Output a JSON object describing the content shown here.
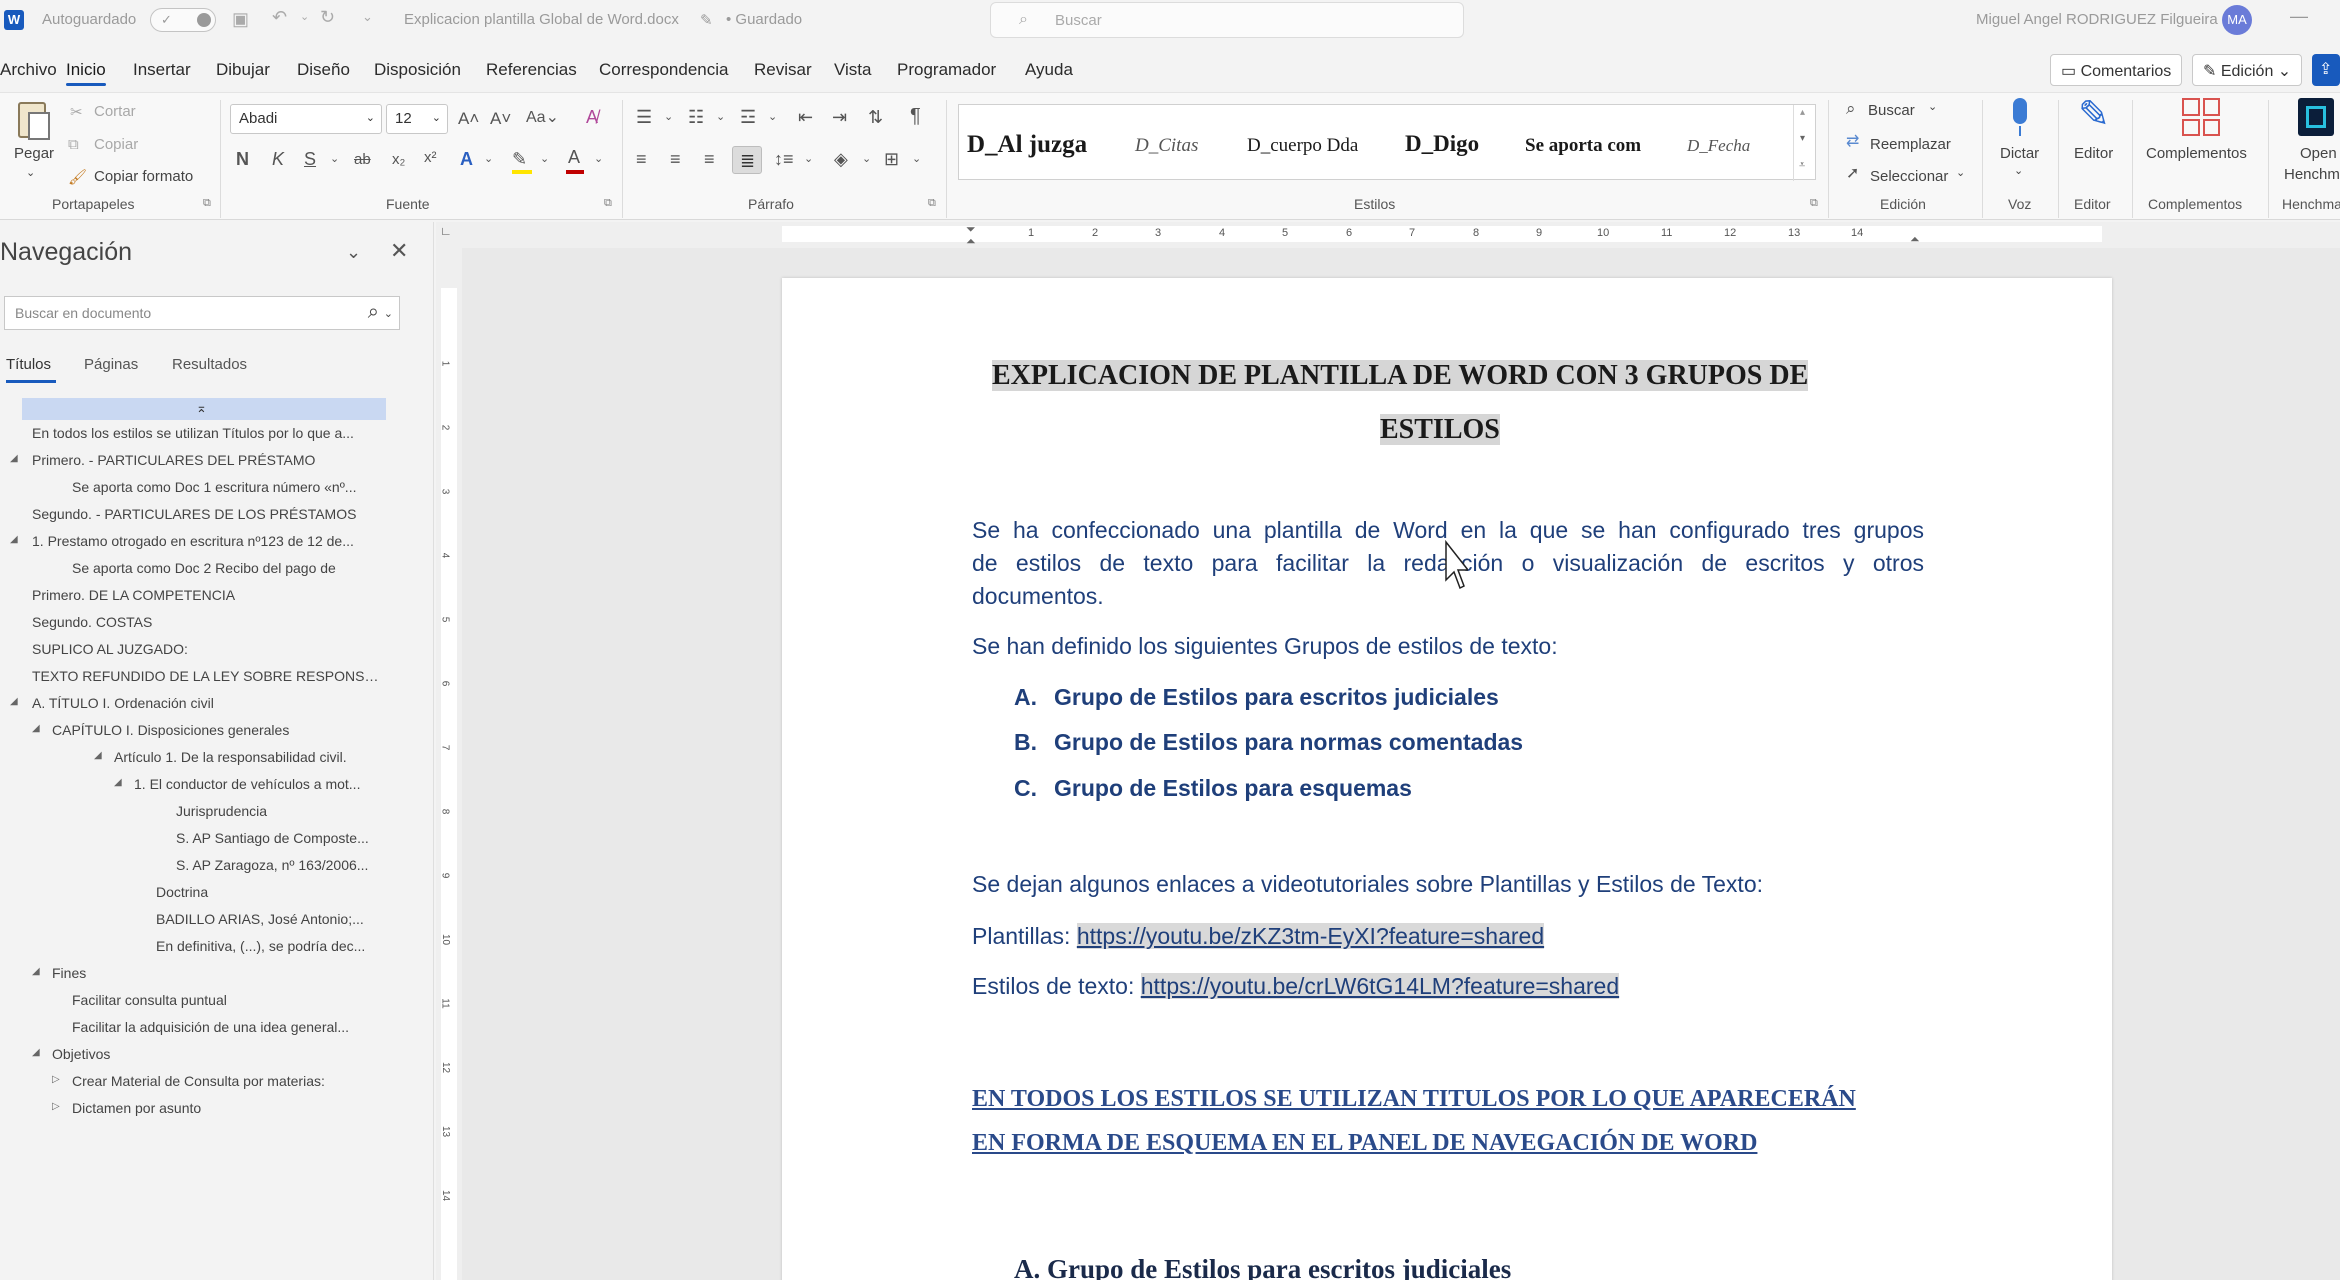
{
  "titlebar": {
    "autosave": "Autoguardado",
    "filename": "Explicacion plantilla Global de Word.docx",
    "save_status": "• Guardado",
    "search_placeholder": "Buscar",
    "user": "Miguel Angel RODRIGUEZ Filgueira",
    "initials": "MA"
  },
  "menu": [
    "Archivo",
    "Inicio",
    "Insertar",
    "Dibujar",
    "Diseño",
    "Disposición",
    "Referencias",
    "Correspondencia",
    "Revisar",
    "Vista",
    "Programador",
    "Ayuda"
  ],
  "menu_active": "Inicio",
  "right_buttons": {
    "comments": "Comentarios",
    "editing": "Edición"
  },
  "ribbon": {
    "clipboard": {
      "paste": "Pegar",
      "cut": "Cortar",
      "copy": "Copiar",
      "format": "Copiar formato",
      "label": "Portapapeles"
    },
    "font": {
      "name": "Abadi",
      "size": "12",
      "label": "Fuente"
    },
    "paragraph": {
      "label": "Párrafo"
    },
    "styles": {
      "items": [
        "D_Al juzga",
        "D_Citas",
        "D_cuerpo Dda",
        "D_Digo",
        "Se aporta com",
        "D_Fecha"
      ],
      "label": "Estilos"
    },
    "editing": {
      "find": "Buscar",
      "replace": "Reemplazar",
      "select": "Seleccionar",
      "label": "Edición"
    },
    "voice": {
      "dictate": "Dictar",
      "label": "Voz"
    },
    "editor": {
      "editor": "Editor",
      "label": "Editor"
    },
    "addins": {
      "addins": "Complementos",
      "label": "Complementos"
    },
    "henchman": {
      "open": "Open",
      "open2": "Henchm",
      "label": "Henchma"
    }
  },
  "nav": {
    "title": "Navegación",
    "search_placeholder": "Buscar en documento",
    "tabs": [
      "Títulos",
      "Páginas",
      "Resultados"
    ],
    "items": [
      "En todos los estilos se utilizan Títulos por lo que a...",
      "Primero. -  PARTICULARES DEL PRÉSTAMO",
      "Se aporta como Doc 1 escritura número «nº...",
      "Segundo. -  PARTICULARES DE LOS PRÉSTAMOS",
      "1. Prestamo otrogado en escritura nº123 de 12 de...",
      "Se aporta como Doc 2 Recibo del pago de",
      "Primero. DE LA COMPETENCIA",
      "Segundo. COSTAS",
      "SUPLICO AL JUZGADO:",
      "TEXTO REFUNDIDO DE LA LEY SOBRE RESPONSAB...",
      "A. TÍTULO I. Ordenación civil",
      "CAPÍTULO I. Disposiciones generales",
      "Artículo 1. De la responsabilidad civil.",
      "1. El conductor de vehículos a mot...",
      "Jurisprudencia",
      "S. AP Santiago de Composte...",
      "S. AP Zaragoza, nº 163/2006...",
      "Doctrina",
      "BADILLO ARIAS, José Antonio;...",
      "En definitiva, (...), se podría dec...",
      "Fines",
      "Facilitar consulta puntual",
      "Facilitar la adquisición de una idea general...",
      "Objetivos",
      "Crear Material de Consulta por materias:",
      "Dictamen por asunto"
    ]
  },
  "ruler_numbers": [
    "1",
    "2",
    "3",
    "4",
    "5",
    "6",
    "7",
    "8",
    "9",
    "10",
    "11",
    "12",
    "13",
    "14"
  ],
  "vruler_numbers": [
    "1",
    "2",
    "3",
    "4",
    "5",
    "6",
    "7",
    "8",
    "9",
    "10",
    "11",
    "12",
    "13",
    "14"
  ],
  "doc": {
    "title1": "EXPLICACION DE PLANTILLA DE WORD CON 3 GRUPOS DE",
    "title2": "ESTILOS",
    "p1_l1": "Se ha confeccionado una plantilla de Word en la que se han configurado tres grupos",
    "p1_l2": "de estilos de texto para facilitar la redacción o visualización de escritos y otros",
    "p1_l3": "documentos.",
    "p2": "Se han definido los siguientes Grupos de estilos de texto:",
    "list": [
      {
        "letter": "A.",
        "text": "Grupo de Estilos para escritos judiciales"
      },
      {
        "letter": "B.",
        "text": "Grupo de Estilos para normas comentadas"
      },
      {
        "letter": "C.",
        "text": "Grupo de Estilos para esquemas"
      }
    ],
    "p3": "Se dejan algunos enlaces a videotutoriales sobre Plantillas y Estilos de Texto:",
    "plantillas_label": "Plantillas: ",
    "plantillas_link": "https://youtu.be/zKZ3tm-EyXI?feature=shared",
    "estilos_label": "Estilos de texto: ",
    "estilos_link": "https://youtu.be/crLW6tG14LM?feature=shared",
    "caps1": "EN TODOS LOS ESTILOS SE UTILIZAN TITULOS POR LO QUE APARECERÁN",
    "caps2": "EN FORMA DE ESQUEMA EN EL PANEL DE NAVEGACIÓN DE WORD",
    "heading_a": "A. Grupo de Estilos para escritos judiciales"
  },
  "colors": {
    "accent": "#185abd",
    "doc_text": "#1f3f7a",
    "highlight": "#d6d6d6"
  }
}
